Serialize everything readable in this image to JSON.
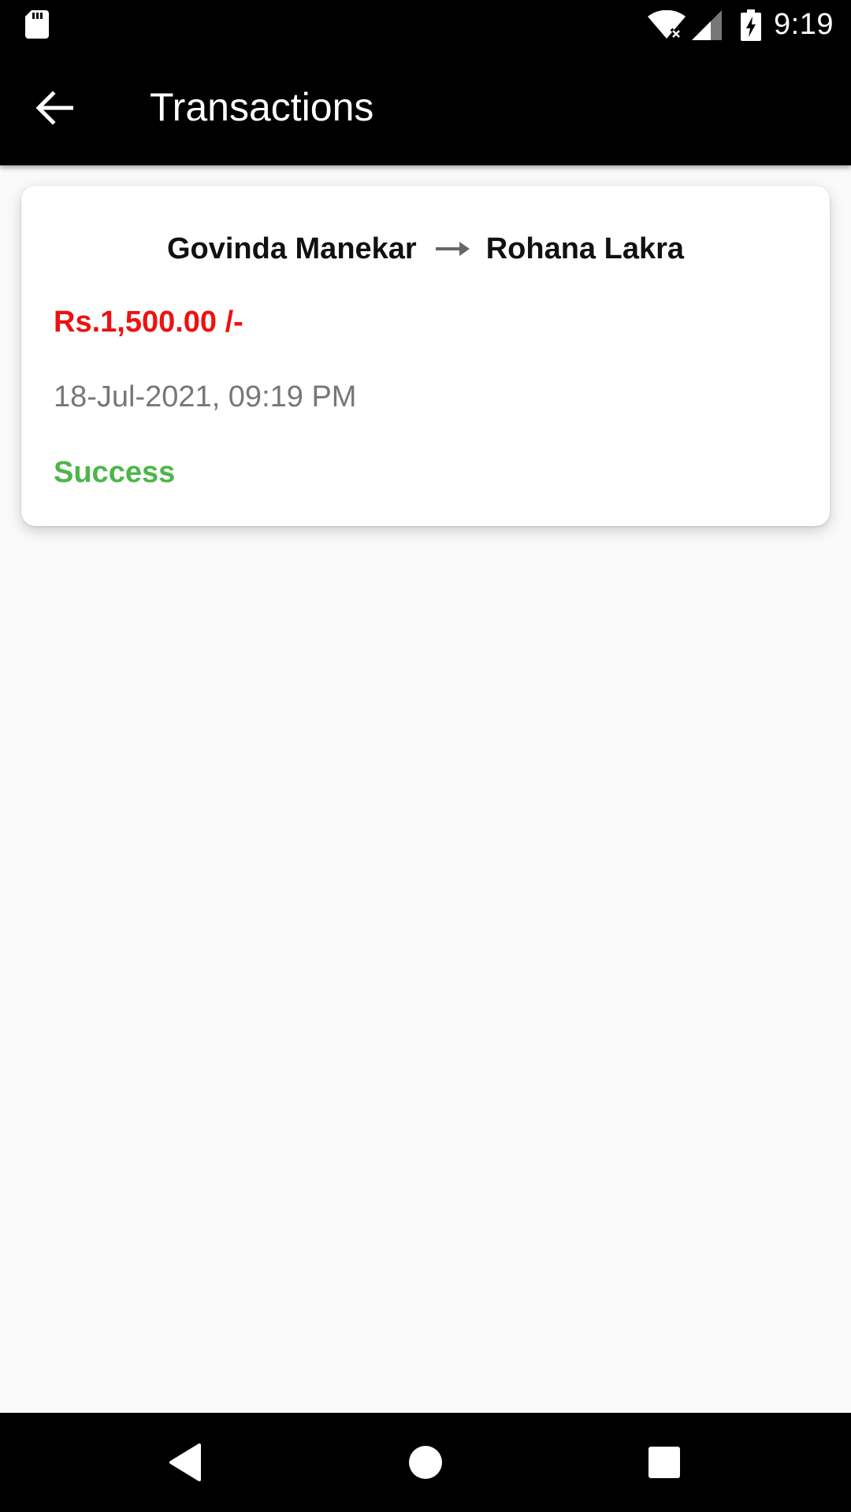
{
  "status_bar": {
    "time": "9:19",
    "icons": [
      "sd-card-icon",
      "wifi-icon",
      "cell-signal-icon",
      "battery-charging-icon"
    ]
  },
  "app_bar": {
    "title": "Transactions",
    "back_icon": "arrow-back-icon"
  },
  "transaction": {
    "from": "Govinda Manekar",
    "to": "Rohana Lakra",
    "amount": "Rs.1,500.00 /-",
    "datetime": "18-Jul-2021, 09:19 PM",
    "status": "Success"
  },
  "colors": {
    "amount": "#ee1111",
    "status_success": "#4cb648",
    "datetime": "#777777",
    "background": "#fafafa",
    "bars": "#000000"
  },
  "nav_bar": {
    "icons": [
      "nav-back-icon",
      "nav-home-icon",
      "nav-recents-icon"
    ]
  }
}
